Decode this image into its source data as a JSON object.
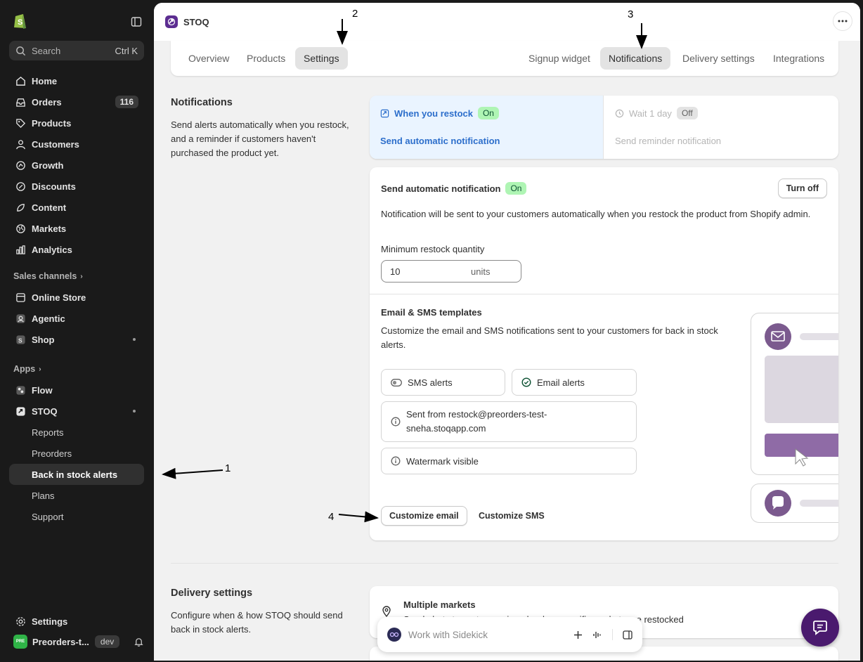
{
  "sidebar": {
    "search": {
      "placeholder": "Search",
      "shortcut": "Ctrl K"
    },
    "items": [
      {
        "label": "Home",
        "icon": "home-icon"
      },
      {
        "label": "Orders",
        "icon": "inbox-icon",
        "badge": "116"
      },
      {
        "label": "Products",
        "icon": "tag-icon"
      },
      {
        "label": "Customers",
        "icon": "person-icon"
      },
      {
        "label": "Growth",
        "icon": "growth-icon"
      },
      {
        "label": "Discounts",
        "icon": "discount-icon"
      },
      {
        "label": "Content",
        "icon": "content-icon"
      },
      {
        "label": "Markets",
        "icon": "globe-icon"
      },
      {
        "label": "Analytics",
        "icon": "bar-chart-icon"
      }
    ],
    "sales_channels": {
      "label": "Sales channels",
      "items": [
        {
          "label": "Online Store",
          "icon": "store-icon"
        },
        {
          "label": "Agentic",
          "icon": "agentic-icon"
        },
        {
          "label": "Shop",
          "icon": "shop-icon"
        }
      ]
    },
    "apps": {
      "label": "Apps",
      "items": [
        {
          "label": "Flow",
          "icon": "flow-icon"
        },
        {
          "label": "STOQ",
          "icon": "stoq-icon"
        }
      ],
      "stoq_sub": [
        {
          "label": "Reports"
        },
        {
          "label": "Preorders"
        },
        {
          "label": "Back in stock alerts",
          "active": true
        },
        {
          "label": "Plans"
        },
        {
          "label": "Support"
        }
      ]
    },
    "settings": "Settings",
    "store": {
      "name": "Preorders-t...",
      "avatar_text": "PRE",
      "env": "dev"
    }
  },
  "header": {
    "app_title": "STOQ"
  },
  "tabs": {
    "left": [
      "Overview",
      "Products",
      "Settings"
    ],
    "right": [
      "Signup widget",
      "Notifications",
      "Delivery settings",
      "Integrations"
    ],
    "active_left": "Settings",
    "active_right": "Notifications"
  },
  "notifications": {
    "title": "Notifications",
    "desc": "Send alerts automatically when you restock, and a reminder if customers haven't purchased the product yet.",
    "toggle": {
      "left": {
        "title": "When you restock",
        "status": "On",
        "link": "Send automatic notification"
      },
      "right": {
        "title": "Wait 1 day",
        "status": "Off",
        "link": "Send reminder notification"
      }
    },
    "auto": {
      "title": "Send automatic notification",
      "status": "On",
      "turn_off": "Turn off",
      "desc": "Notification will be sent to your customers automatically when you restock the product from Shopify admin.",
      "min_label": "Minimum restock quantity",
      "min_value": "10",
      "min_unit": "units",
      "templates_title": "Email & SMS templates",
      "templates_desc": "Customize the email and SMS notifications sent to your customers for back in stock alerts.",
      "chips": {
        "sms": "SMS alerts",
        "email": "Email alerts",
        "sent_from": "Sent from restock@preorders-test-sneha.stoqapp.com",
        "watermark": "Watermark visible"
      },
      "customize_email": "Customize email",
      "customize_sms": "Customize SMS"
    }
  },
  "delivery": {
    "title": "Delivery settings",
    "desc": "Configure when & how STOQ should send back in stock alerts.",
    "market_title": "Multiple markets",
    "market_desc": "Send alerts to customers in only when specific markets are restocked"
  },
  "sidekick": {
    "placeholder": "Work with Sidekick"
  },
  "annotations": [
    "1",
    "2",
    "3",
    "4"
  ],
  "colors": {
    "accent_blue": "#2c6ecb",
    "on_green": "#aff5b4",
    "sidebar_bg": "#1a1a1a",
    "chat_purple": "#4a1a6e"
  }
}
